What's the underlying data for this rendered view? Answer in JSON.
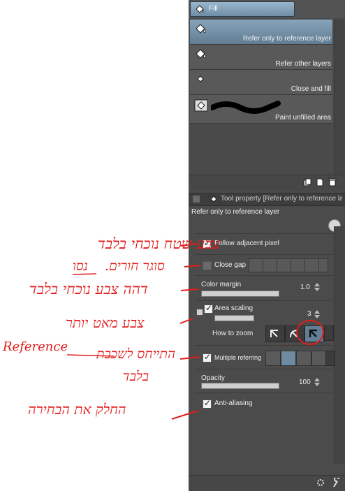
{
  "sub_tool_tab": {
    "label": "Fill"
  },
  "sub_tools": [
    {
      "label": "Refer only to reference layer",
      "selected": true
    },
    {
      "label": "Refer other layers",
      "selected": false
    },
    {
      "label": "Close and fill",
      "selected": false
    },
    {
      "label": "Paint unfilled area",
      "selected": false
    }
  ],
  "tool_property": {
    "header": "Tool property [Refer only to reference la",
    "title": "Refer only to reference layer",
    "follow_adjacent_pixel": {
      "label": "Follow adjacent pixel",
      "checked": true
    },
    "close_gap": {
      "label": "Close gap",
      "checked": false
    },
    "color_margin": {
      "label": "Color margin",
      "value": "1.0"
    },
    "area_scaling": {
      "label": "Area scaling",
      "checked": true,
      "value": "3"
    },
    "how_to_zoom": {
      "label": "How to zoom"
    },
    "multiple_referring": {
      "label": "Multiple referring",
      "checked": true
    },
    "opacity": {
      "label": "Opacity",
      "value": "100"
    },
    "anti_aliasing": {
      "label": "Anti-aliasing",
      "checked": true
    }
  },
  "annotations": {
    "a1": "צבע שטח נוכחי בלבד",
    "a2_part1": "סוגר חורים.",
    "a2_part2": "נסו",
    "a3": "דהה צבע נוכחי בלבד",
    "a4": "צבע מאט יותר",
    "a5_line1_ltr": "Reference",
    "a5_line1_rtl": "התייחס לשכבת",
    "a5_line2": "בלבד",
    "a6": "החלק את הבחירה"
  },
  "colors": {
    "annotation": "#e31b1b",
    "panel_bg": "#4b4b4b",
    "selection": "#7f9bb2"
  }
}
